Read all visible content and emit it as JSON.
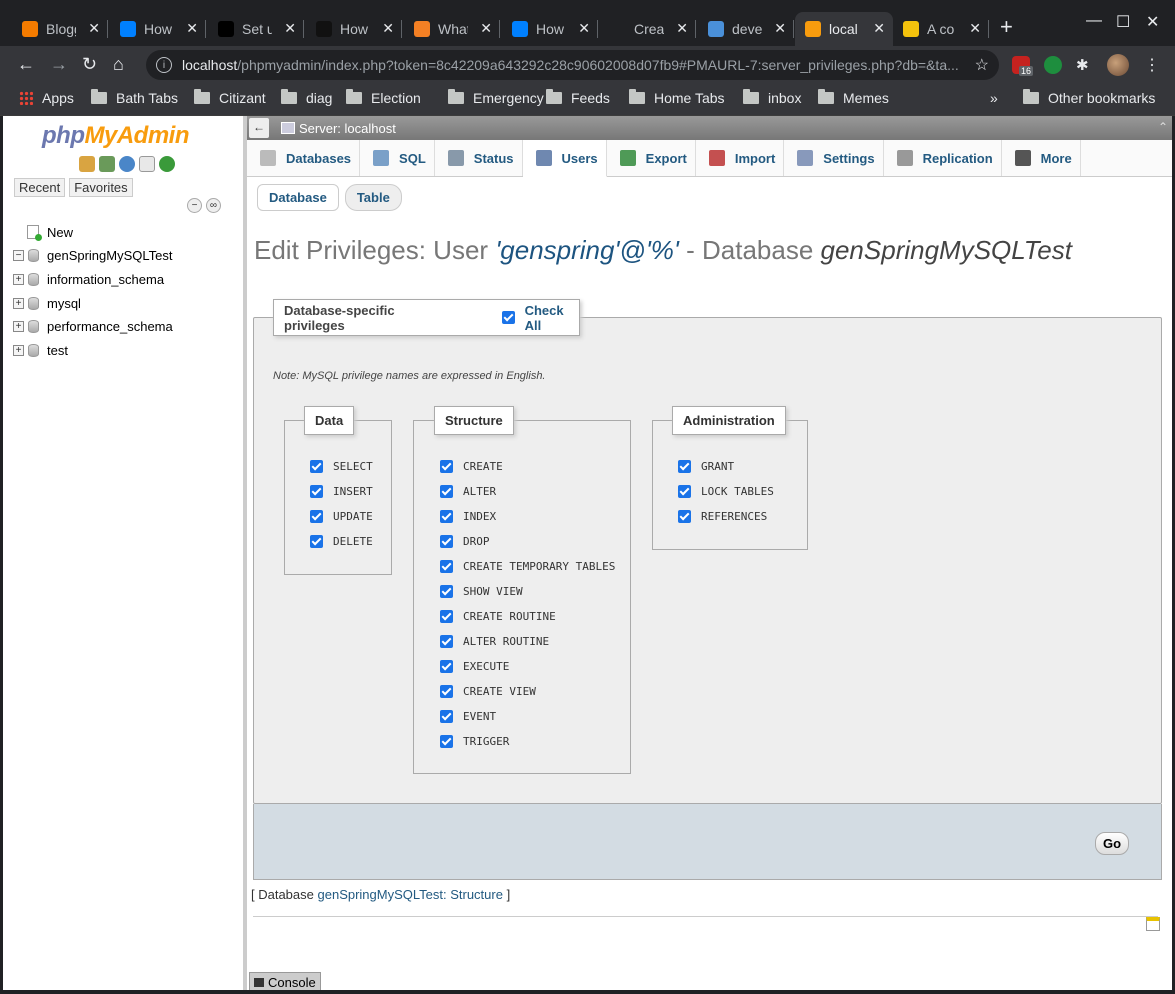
{
  "browser": {
    "tabs": [
      {
        "title": "Blogg",
        "favicon_color": "#f57c00"
      },
      {
        "title": "How",
        "favicon_color": "#0080ff"
      },
      {
        "title": "Set u",
        "favicon_color": "#000000"
      },
      {
        "title": "How",
        "favicon_color": "#111111"
      },
      {
        "title": "What",
        "favicon_color": "#f48024"
      },
      {
        "title": "How",
        "favicon_color": "#0080ff"
      },
      {
        "title": "Creat",
        "favicon_color": "#202124"
      },
      {
        "title": "deve",
        "favicon_color": "#4a90d9"
      },
      {
        "title": "local",
        "favicon_color": "#f89c0e",
        "active": true
      },
      {
        "title": "A co",
        "favicon_color": "#f4c20d"
      }
    ],
    "url": {
      "host": "localhost",
      "path": "/phpmyadmin/index.php?token=8c42209a643292c28c90602008d07fb9#PMAURL-7:server_privileges.php?db=&ta..."
    },
    "extension_badge": "16",
    "bookmarks": [
      "Apps",
      "Bath Tabs",
      "Citizant",
      "diag",
      "Election",
      "Emergency",
      "Feeds",
      "Home Tabs",
      "inbox",
      "Memes"
    ],
    "bookmarks_overflow": "»",
    "other_bookmarks": "Other bookmarks"
  },
  "nav": {
    "logo_php": "php",
    "logo_myadmin": "MyAdmin",
    "recent": "Recent",
    "favorites": "Favorites",
    "new_label": "New",
    "databases": [
      {
        "name": "genSpringMySQLTest",
        "expander": "−"
      },
      {
        "name": "information_schema",
        "expander": "+"
      },
      {
        "name": "mysql",
        "expander": "+"
      },
      {
        "name": "performance_schema",
        "expander": "+"
      },
      {
        "name": "test",
        "expander": "+"
      }
    ]
  },
  "main": {
    "server_label": "Server: localhost",
    "menu": [
      {
        "label": "Databases",
        "icon_color": "#bbbbbb"
      },
      {
        "label": "SQL",
        "icon_color": "#7aa0c8"
      },
      {
        "label": "Status",
        "icon_color": "#8899aa"
      },
      {
        "label": "Users",
        "icon_color": "#6f88b0",
        "active": true
      },
      {
        "label": "Export",
        "icon_color": "#4f9a57"
      },
      {
        "label": "Import",
        "icon_color": "#c45050"
      },
      {
        "label": "Settings",
        "icon_color": "#8899bb"
      },
      {
        "label": "Replication",
        "icon_color": "#999999"
      },
      {
        "label": "More",
        "icon_color": "#555555"
      }
    ],
    "subtabs": [
      "Database",
      "Table"
    ],
    "heading": {
      "prefix": "Edit Privileges: User ",
      "user": "'genspring'@'%'",
      "middle": " - Database ",
      "database": "genSpringMySQLTest"
    },
    "fieldset_title": "Database-specific privileges",
    "check_all": "Check All",
    "note": "Note: MySQL privilege names are expressed in English.",
    "groups": {
      "data": {
        "title": "Data",
        "privileges": [
          "SELECT",
          "INSERT",
          "UPDATE",
          "DELETE"
        ]
      },
      "structure": {
        "title": "Structure",
        "privileges": [
          "CREATE",
          "ALTER",
          "INDEX",
          "DROP",
          "CREATE TEMPORARY TABLES",
          "SHOW VIEW",
          "CREATE ROUTINE",
          "ALTER ROUTINE",
          "EXECUTE",
          "CREATE VIEW",
          "EVENT",
          "TRIGGER"
        ]
      },
      "administration": {
        "title": "Administration",
        "privileges": [
          "GRANT",
          "LOCK TABLES",
          "REFERENCES"
        ]
      }
    },
    "go_button": "Go",
    "structure_link": {
      "open": "[ Database ",
      "link": "genSpringMySQLTest: Structure",
      "close": " ]"
    },
    "console": "Console"
  }
}
